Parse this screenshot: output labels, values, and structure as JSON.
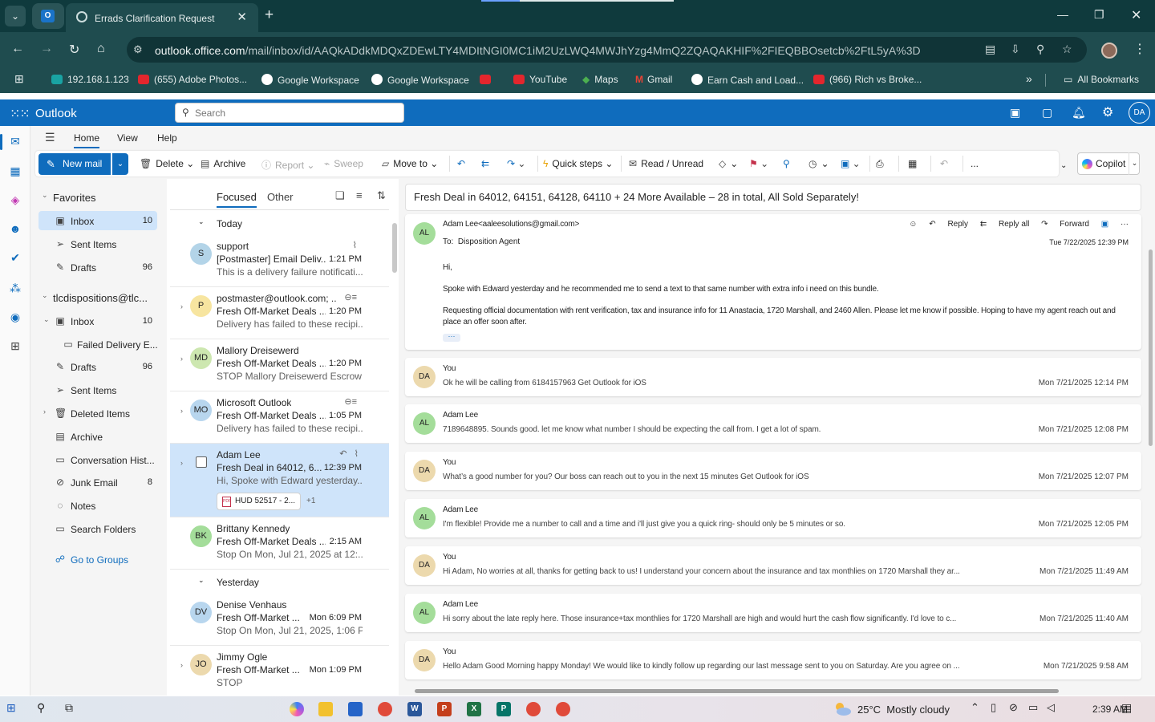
{
  "browser": {
    "tab_title": "Errads Clarification Request",
    "url_host": "outlook.office.com",
    "url_path": "/mail/inbox/id/AAQkADdkMDQxZDEwLTY4MDItNGI0MC1iM2UzLWQ4MWJhYzg4MmQ2ZQAQAKHIF%2FIEQBBOsetcb%2FtL5yA%3D",
    "bookmarks": [
      {
        "label": "192.168.1.123",
        "icon": "network-icon"
      },
      {
        "label": "(655) Adobe Photos...",
        "icon": "youtube-icon"
      },
      {
        "label": "Google Workspace",
        "icon": "google-workspace-icon"
      },
      {
        "label": "Google Workspace",
        "icon": "google-workspace-icon"
      },
      {
        "label": "",
        "icon": "youtube-icon"
      },
      {
        "label": "YouTube",
        "icon": "youtube-icon"
      },
      {
        "label": "Maps",
        "icon": "maps-icon"
      },
      {
        "label": "Gmail",
        "icon": "gmail-icon"
      },
      {
        "label": "Earn Cash and Load...",
        "icon": "google-workspace-icon"
      },
      {
        "label": "(966) Rich vs Broke...",
        "icon": "youtube-icon"
      }
    ],
    "bookmarks_overflow": "»",
    "all_bookmarks": "All Bookmarks"
  },
  "outlook": {
    "app_name": "Outlook",
    "search_placeholder": "Search",
    "user_initials": "DA",
    "accent": "#0f6cbd"
  },
  "ribbon_tabs": [
    "Home",
    "View",
    "Help"
  ],
  "ribbon": {
    "new_mail": "New mail",
    "delete": "Delete",
    "archive": "Archive",
    "report": "Report",
    "sweep": "Sweep",
    "move_to": "Move to",
    "quick_steps": "Quick steps",
    "read_unread": "Read / Unread",
    "more": "...",
    "copilot": "Copilot"
  },
  "folders": {
    "favorites_header": "Favorites",
    "favorites": [
      {
        "label": "Inbox",
        "count": "10"
      },
      {
        "label": "Sent Items",
        "count": ""
      },
      {
        "label": "Drafts",
        "count": "96"
      }
    ],
    "account": "tlcdispositions@tlc...",
    "account_folders": [
      {
        "label": "Inbox",
        "count": "10"
      },
      {
        "label": "Failed Delivery E...",
        "count": ""
      },
      {
        "label": "Drafts",
        "count": "96"
      },
      {
        "label": "Sent Items",
        "count": ""
      },
      {
        "label": "Deleted Items",
        "count": ""
      },
      {
        "label": "Archive",
        "count": ""
      },
      {
        "label": "Conversation Hist...",
        "count": ""
      },
      {
        "label": "Junk Email",
        "count": "8"
      },
      {
        "label": "Notes",
        "count": ""
      },
      {
        "label": "Search Folders",
        "count": ""
      }
    ],
    "go_to_groups": "Go to Groups"
  },
  "message_list": {
    "tab_focused": "Focused",
    "tab_other": "Other",
    "group_today": "Today",
    "group_yesterday": "Yesterday",
    "items": [
      {
        "initials": "S",
        "from": "support",
        "subject": "[Postmaster] Email Deliv...",
        "time": "1:21 PM",
        "preview": "This is a delivery failure notificati..."
      },
      {
        "initials": "P",
        "from": "postmaster@outlook.com; ...",
        "subject": "Fresh Off-Market Deals ...",
        "time": "1:20 PM",
        "preview": "Delivery has failed to these recipi..."
      },
      {
        "initials": "MD",
        "from": "Mallory Dreisewerd",
        "subject": "Fresh Off-Market Deals ...",
        "time": "1:20 PM",
        "preview": "STOP Mallory Dreisewerd Escrow ..."
      },
      {
        "initials": "MO",
        "from": "Microsoft Outlook",
        "subject": "Fresh Off-Market Deals ...",
        "time": "1:05 PM",
        "preview": "Delivery has failed to these recipi..."
      },
      {
        "initials": "",
        "from": "Adam Lee",
        "subject": "Fresh Deal in 64012, 6...",
        "time": "12:39 PM",
        "preview": "Hi, Spoke with Edward yesterday...",
        "attachment": "HUD 52517 - 2...",
        "more_attachments": "+1"
      },
      {
        "initials": "BK",
        "from": "Brittany Kennedy",
        "subject": "Fresh Off-Market Deals ...",
        "time": "2:15 AM",
        "preview": "Stop On Mon, Jul 21, 2025 at 12:..."
      },
      {
        "initials": "DV",
        "from": "Denise Venhaus",
        "subject": "Fresh Off-Market ...",
        "time": "Mon 6:09 PM",
        "preview": "Stop On Mon, Jul 21, 2025, 1:06 P..."
      },
      {
        "initials": "JO",
        "from": "Jimmy Ogle",
        "subject": "Fresh Off-Market ...",
        "time": "Mon 1:09 PM",
        "preview": "STOP"
      }
    ]
  },
  "reading": {
    "subject": "Fresh Deal in 64012, 64151, 64128, 64110 + 24 More Available – 28 in total, All Sold Separately!",
    "first": {
      "initials": "AL",
      "from": "Adam Lee<aaleesolutions@gmail.com>",
      "to_label": "To:",
      "to": "Disposition Agent",
      "date": "Tue 7/22/2025 12:39 PM",
      "reply": "Reply",
      "reply_all": "Reply all",
      "forward": "Forward",
      "body": [
        "Hi,",
        "Spoke with Edward yesterday and he recommended me to send a text to that same number with extra info i need on this bundle.",
        "Requesting official documentation with rent verification, tax and insurance info for 11 Anastacia, 1720 Marshall, and 2460 Allen. Please let me know if possible. Hoping to have my agent reach out and place an offer soon after."
      ],
      "ellipsis": "···"
    },
    "thread": [
      {
        "initials": "DA",
        "name": "You",
        "preview": "Ok he will be calling from 6184157963 Get Outlook for iOS",
        "date": "Mon 7/21/2025 12:14 PM"
      },
      {
        "initials": "AL",
        "name": "Adam Lee",
        "preview": "7189648895. Sounds good. let me know what number I should be expecting the call from. I get a lot of spam.",
        "date": "Mon 7/21/2025 12:08 PM"
      },
      {
        "initials": "DA",
        "name": "You",
        "preview": "What’s a good number for you? Our boss can reach out to you in the next 15 minutes Get Outlook for iOS",
        "date": "Mon 7/21/2025 12:07 PM"
      },
      {
        "initials": "AL",
        "name": "Adam Lee",
        "preview": "I'm flexible! Provide me a number to call and a time and i'll just give you a quick ring- should only be 5 minutes or so.",
        "date": "Mon 7/21/2025 12:05 PM"
      },
      {
        "initials": "DA",
        "name": "You",
        "preview": "Hi Adam, No worries at all, thanks for getting back to us! I understand your concern about the insurance and tax monthlies on 1720 Marshall they ar...",
        "date": "Mon 7/21/2025 11:49 AM"
      },
      {
        "initials": "AL",
        "name": "Adam Lee",
        "preview": "Hi sorry about the late reply here. Those insurance+tax monthlies for 1720 Marshall are high and would hurt the cash flow significantly. I'd love to c...",
        "date": "Mon 7/21/2025 11:40 AM"
      },
      {
        "initials": "DA",
        "name": "You",
        "preview": "Hello Adam Good Morning happy Monday! We would like to kindly follow up regarding our last message sent to you on Saturday. Are you agree on ...",
        "date": "Mon 7/21/2025 9:58 AM"
      }
    ]
  },
  "taskbar": {
    "temperature": "25°C",
    "weather": "Mostly cloudy",
    "time": "2:39 AM"
  }
}
